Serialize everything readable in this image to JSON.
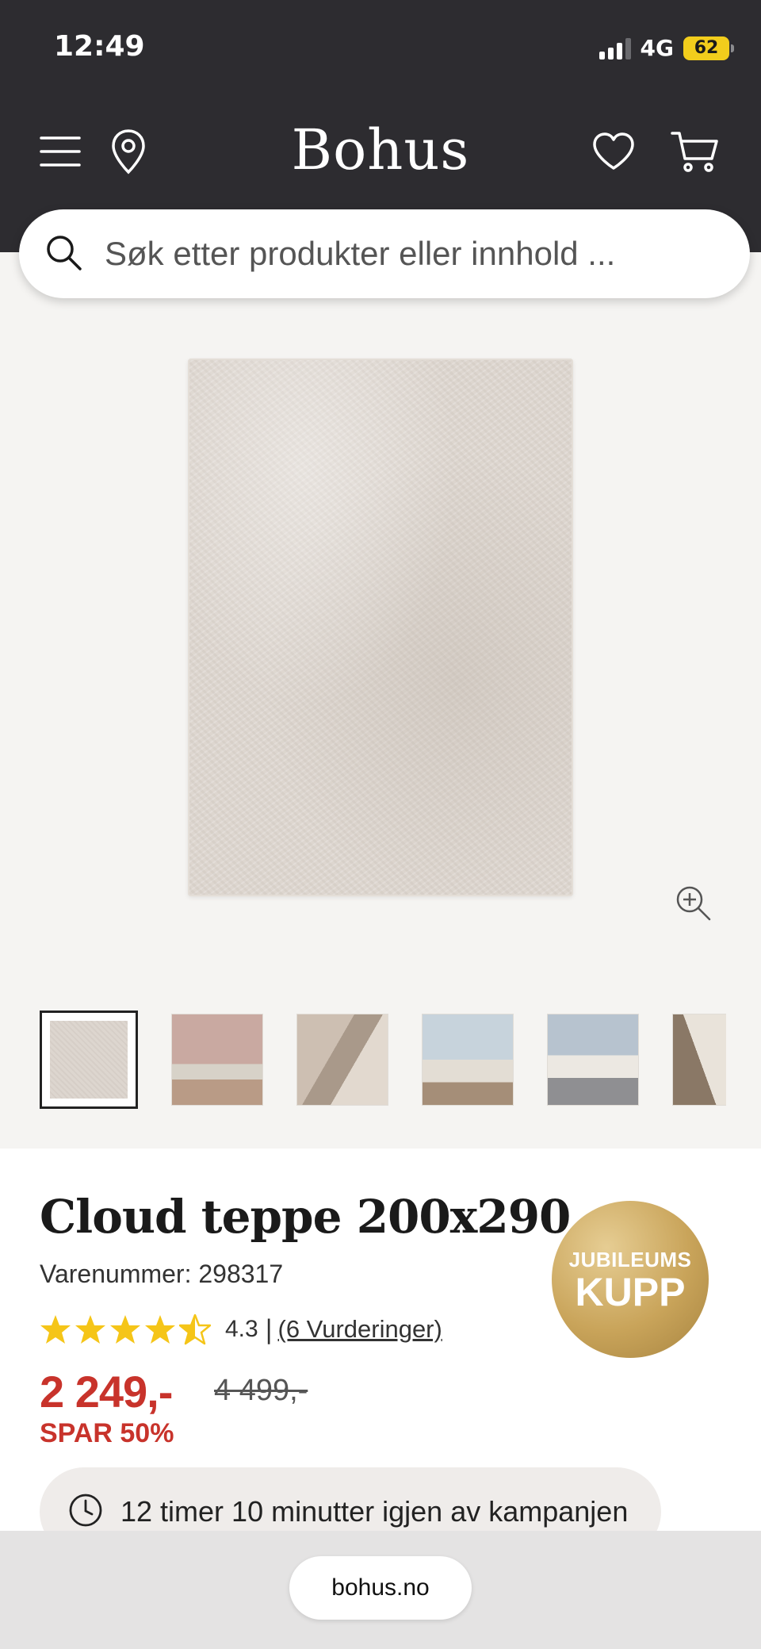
{
  "status_bar": {
    "time": "12:49",
    "network": "4G",
    "battery": "62"
  },
  "header": {
    "logo": "Bohus",
    "icons": [
      "menu-icon",
      "location-pin-icon",
      "heart-icon",
      "cart-icon"
    ]
  },
  "search": {
    "placeholder": "Søk etter produkter eller innhold ..."
  },
  "gallery": {
    "thumbnail_count_visible": 6,
    "selected_index": 0
  },
  "product": {
    "title": "Cloud teppe 200x290",
    "sku": "Varenummer: 298317",
    "rating_value": "4.3",
    "rating_separator": "|",
    "rating_link": "(6 Vurderinger)",
    "rating": 4.5,
    "price": "2 249,-",
    "old_price": "4 499,-",
    "save_text": "SPAR 50%",
    "badge_line1": "JUBILEUMS",
    "badge_line2": "KUPP",
    "timer_text": "12 timer 10 minutter igjen av kampanjen"
  },
  "browser": {
    "url": "bohus.no"
  },
  "colors": {
    "header_bg": "#2d2c30",
    "price_red": "#c8332b",
    "star_yellow": "#f5c518",
    "badge_gold": "#c9a45a"
  }
}
